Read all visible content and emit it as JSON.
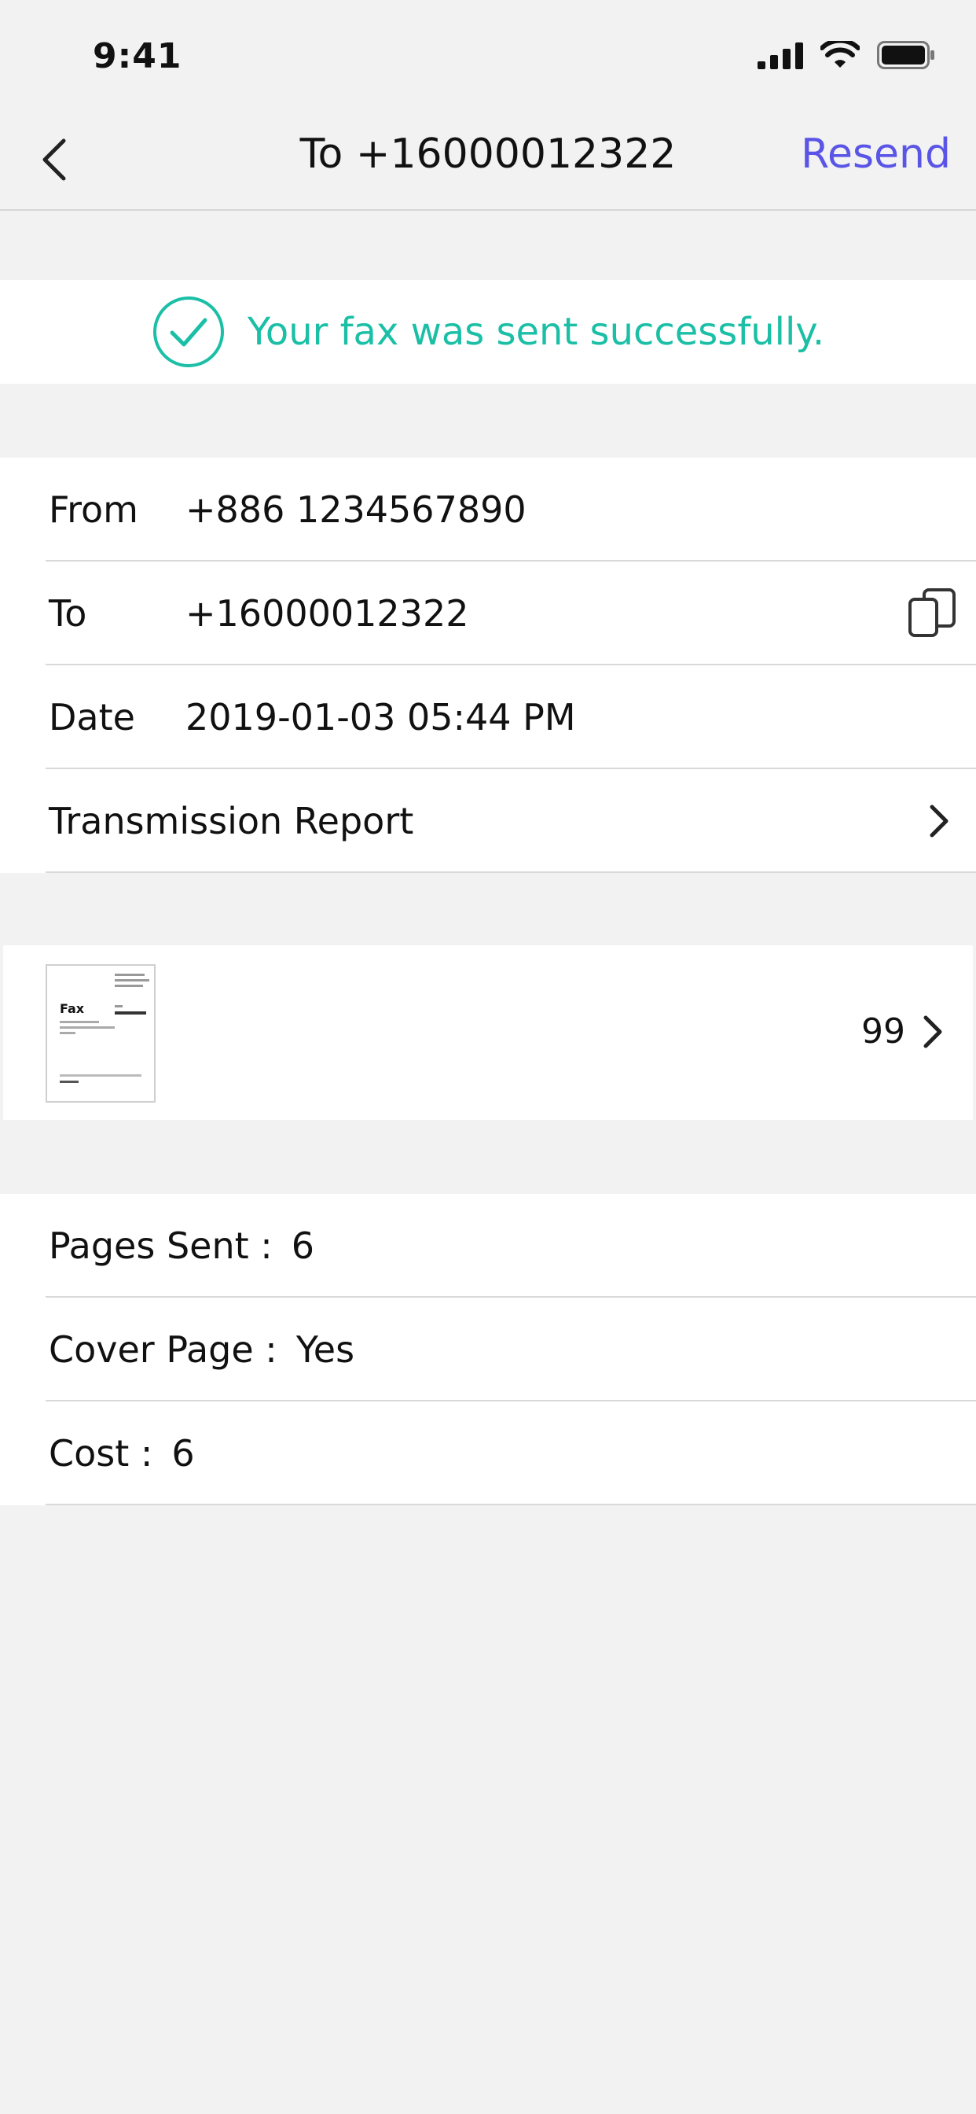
{
  "status": {
    "time": "9:41"
  },
  "nav": {
    "title": "To +16000012322",
    "resend": "Resend"
  },
  "success": {
    "text": "Your fax was sent successfully."
  },
  "details": {
    "from_label": "From",
    "from_value": "+886 1234567890",
    "to_label": "To",
    "to_value": "+16000012322",
    "date_label": "Date",
    "date_value": "2019-01-03  05:44 PM",
    "report_label": "Transmission Report"
  },
  "preview": {
    "count": "99",
    "thumb_title": "Fax"
  },
  "summary": {
    "pages_label": "Pages Sent :",
    "pages_value": "6",
    "cover_label": "Cover Page :",
    "cover_value": "Yes",
    "cost_label": "Cost :",
    "cost_value": "6"
  },
  "colors": {
    "accent": "#5a55e6",
    "success": "#1bbfa6"
  }
}
